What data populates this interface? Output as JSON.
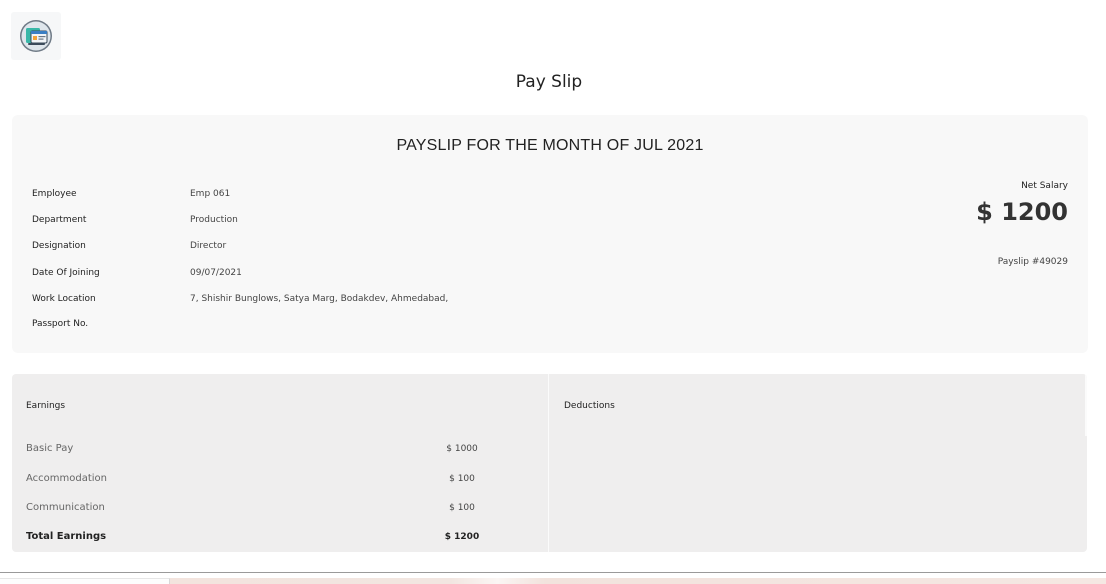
{
  "logo": {
    "icon": "payroll-app-icon"
  },
  "page_title": "Pay Slip",
  "payslip": {
    "heading": "PAYSLIP FOR THE MONTH OF JUL 2021",
    "fields": [
      {
        "label": "Employee",
        "value": "Emp 061"
      },
      {
        "label": "Department",
        "value": "Production"
      },
      {
        "label": "Designation",
        "value": "Director"
      },
      {
        "label": "Date Of Joining",
        "value": "09/07/2021"
      },
      {
        "label": "Work Location",
        "value": "7, Shishir Bunglows, Satya Marg, Bodakdev, Ahmedabad,"
      },
      {
        "label": "Passport No.",
        "value": ""
      }
    ],
    "net_salary_label": "Net Salary",
    "net_salary_amount": "$ 1200",
    "payslip_number": "Payslip #49029"
  },
  "earnings": {
    "heading": "Earnings",
    "items": [
      {
        "label": "Basic Pay",
        "value": "$ 1000"
      },
      {
        "label": "Accommodation",
        "value": "$ 100"
      },
      {
        "label": "Communication",
        "value": "$ 100"
      }
    ],
    "total_label": "Total Earnings",
    "total_value": "$ 1200"
  },
  "deductions": {
    "heading": "Deductions"
  },
  "colors": {
    "card_bg": "#f8f8f8",
    "table_bg": "#efeeee",
    "text": "#222222"
  }
}
